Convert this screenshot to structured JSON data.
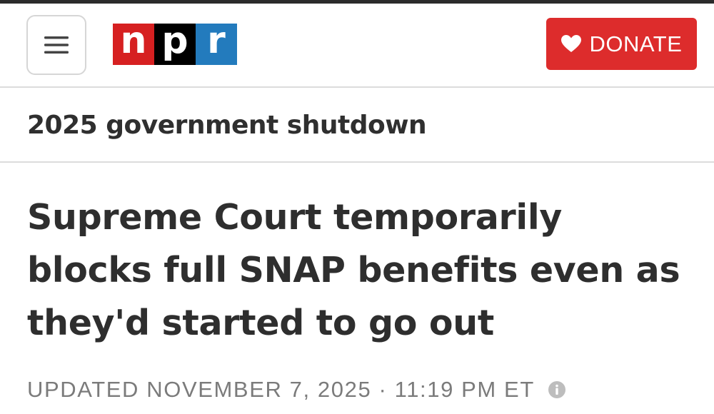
{
  "header": {
    "menu_icon": "hamburger-menu-icon",
    "logo": {
      "letters": [
        "n",
        "p",
        "r"
      ],
      "colors": [
        "#d62021",
        "#000000",
        "#237bbd"
      ]
    },
    "donate": {
      "label": "DONATE",
      "icon": "heart-icon",
      "color": "#dd2c2c"
    }
  },
  "section": {
    "label": "2025 government shutdown"
  },
  "article": {
    "headline": "Supreme Court temporarily blocks full SNAP benefits even as they'd started to go out",
    "dateline": "UPDATED NOVEMBER 7, 2025 · 11:19 PM ET",
    "dateline_icon": "info-icon"
  }
}
